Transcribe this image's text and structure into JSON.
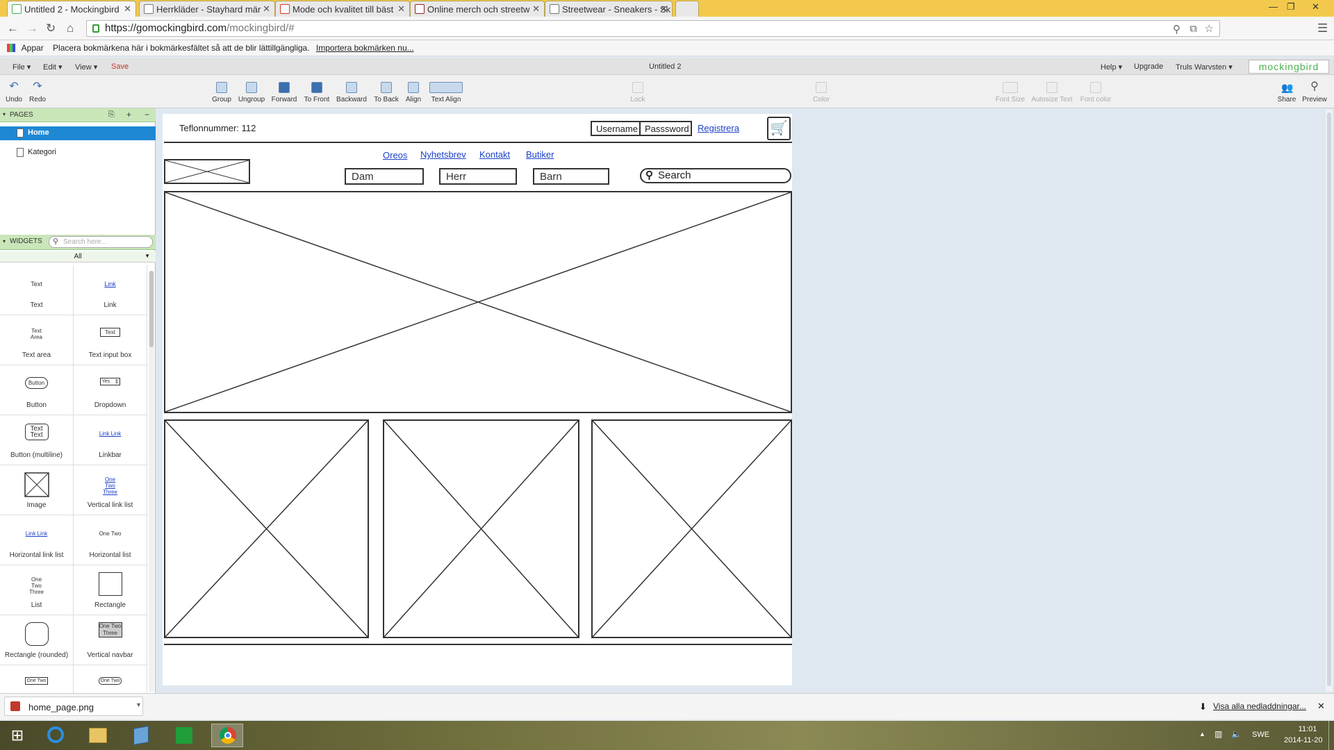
{
  "browser": {
    "tabs": [
      {
        "title": "Untitled 2 - Mockingbird"
      },
      {
        "title": "Herrkläder - Stayhard mär"
      },
      {
        "title": "Mode och kvalitet till bäst"
      },
      {
        "title": "Online merch och streetw"
      },
      {
        "title": "Streetwear - Sneakers - Sk"
      }
    ],
    "url_domain": "https://gomockingbird.com",
    "url_path": "/mockingbird/#",
    "bookmarks_apps": "Appar",
    "bookmarks_hint": "Placera bokmärkena här i bokmärkesfältet så att de blir lättillgängliga.",
    "bookmarks_import": "Importera bokmärken nu..."
  },
  "app": {
    "menu": [
      "File ▾",
      "Edit ▾",
      "View ▾"
    ],
    "save": "Save",
    "doc_title": "Untitled 2",
    "right_menu": [
      "Help ▾",
      "Upgrade",
      "Truls Warvsten ▾"
    ],
    "brand": "mockingbird",
    "toolbar": {
      "undo": "Undo",
      "redo": "Redo",
      "group": "Group",
      "ungroup": "Ungroup",
      "forward": "Forward",
      "to_front": "To Front",
      "backward": "Backward",
      "to_back": "To Back",
      "align": "Align",
      "text_align": "Text Align",
      "lock": "Lock",
      "color": "Color",
      "font_size": "Font Size",
      "autosize_text": "Autosize Text",
      "font_color": "Font color",
      "share": "Share",
      "preview": "Preview"
    }
  },
  "left_panel": {
    "pages_header": "PAGES",
    "pages": [
      {
        "label": "Home",
        "selected": true
      },
      {
        "label": "Kategori",
        "selected": false
      }
    ],
    "widgets_header": "WIDGETS",
    "widgets_search_placeholder": "Search here...",
    "widgets_filter": "All",
    "widgets": [
      {
        "label": "Text",
        "preview": "Text"
      },
      {
        "label": "Link",
        "preview": "Link"
      },
      {
        "label": "Text area",
        "preview": "Text Area"
      },
      {
        "label": "Text input box",
        "preview": "Text"
      },
      {
        "label": "Button",
        "preview": "Button"
      },
      {
        "label": "Dropdown",
        "preview": "Yes"
      },
      {
        "label": "Button (multiline)",
        "preview": "Text Text"
      },
      {
        "label": "Linkbar",
        "preview": "Link Link"
      },
      {
        "label": "Image",
        "preview": ""
      },
      {
        "label": "Vertical link list",
        "preview": "One Two Three"
      },
      {
        "label": "Horizontal link list",
        "preview": "Link Link"
      },
      {
        "label": "Horizontal list",
        "preview": "One Two"
      },
      {
        "label": "List",
        "preview": "One Two Three"
      },
      {
        "label": "Rectangle",
        "preview": ""
      },
      {
        "label": "Rectangle (rounded)",
        "preview": ""
      },
      {
        "label": "Vertical navbar",
        "preview": "One Two Three"
      },
      {
        "label": "",
        "preview": "One Two"
      },
      {
        "label": "",
        "preview": "One Two"
      }
    ]
  },
  "mockup": {
    "phone": "Teflonnummer: 112",
    "username": "Username",
    "password": "Passsword",
    "register": "Registrera",
    "nav_links": [
      "Oreos",
      "Nyhetsbrev",
      "Kontakt",
      "Butiker"
    ],
    "category_fields": [
      "Dam",
      "Herr",
      "Barn"
    ],
    "search": "Search"
  },
  "downloads": {
    "file": "home_page.png",
    "show_all": "Visa alla nedladdningar..."
  },
  "taskbar": {
    "lang": "SWE",
    "time": "11:01",
    "date": "2014-11-20"
  }
}
